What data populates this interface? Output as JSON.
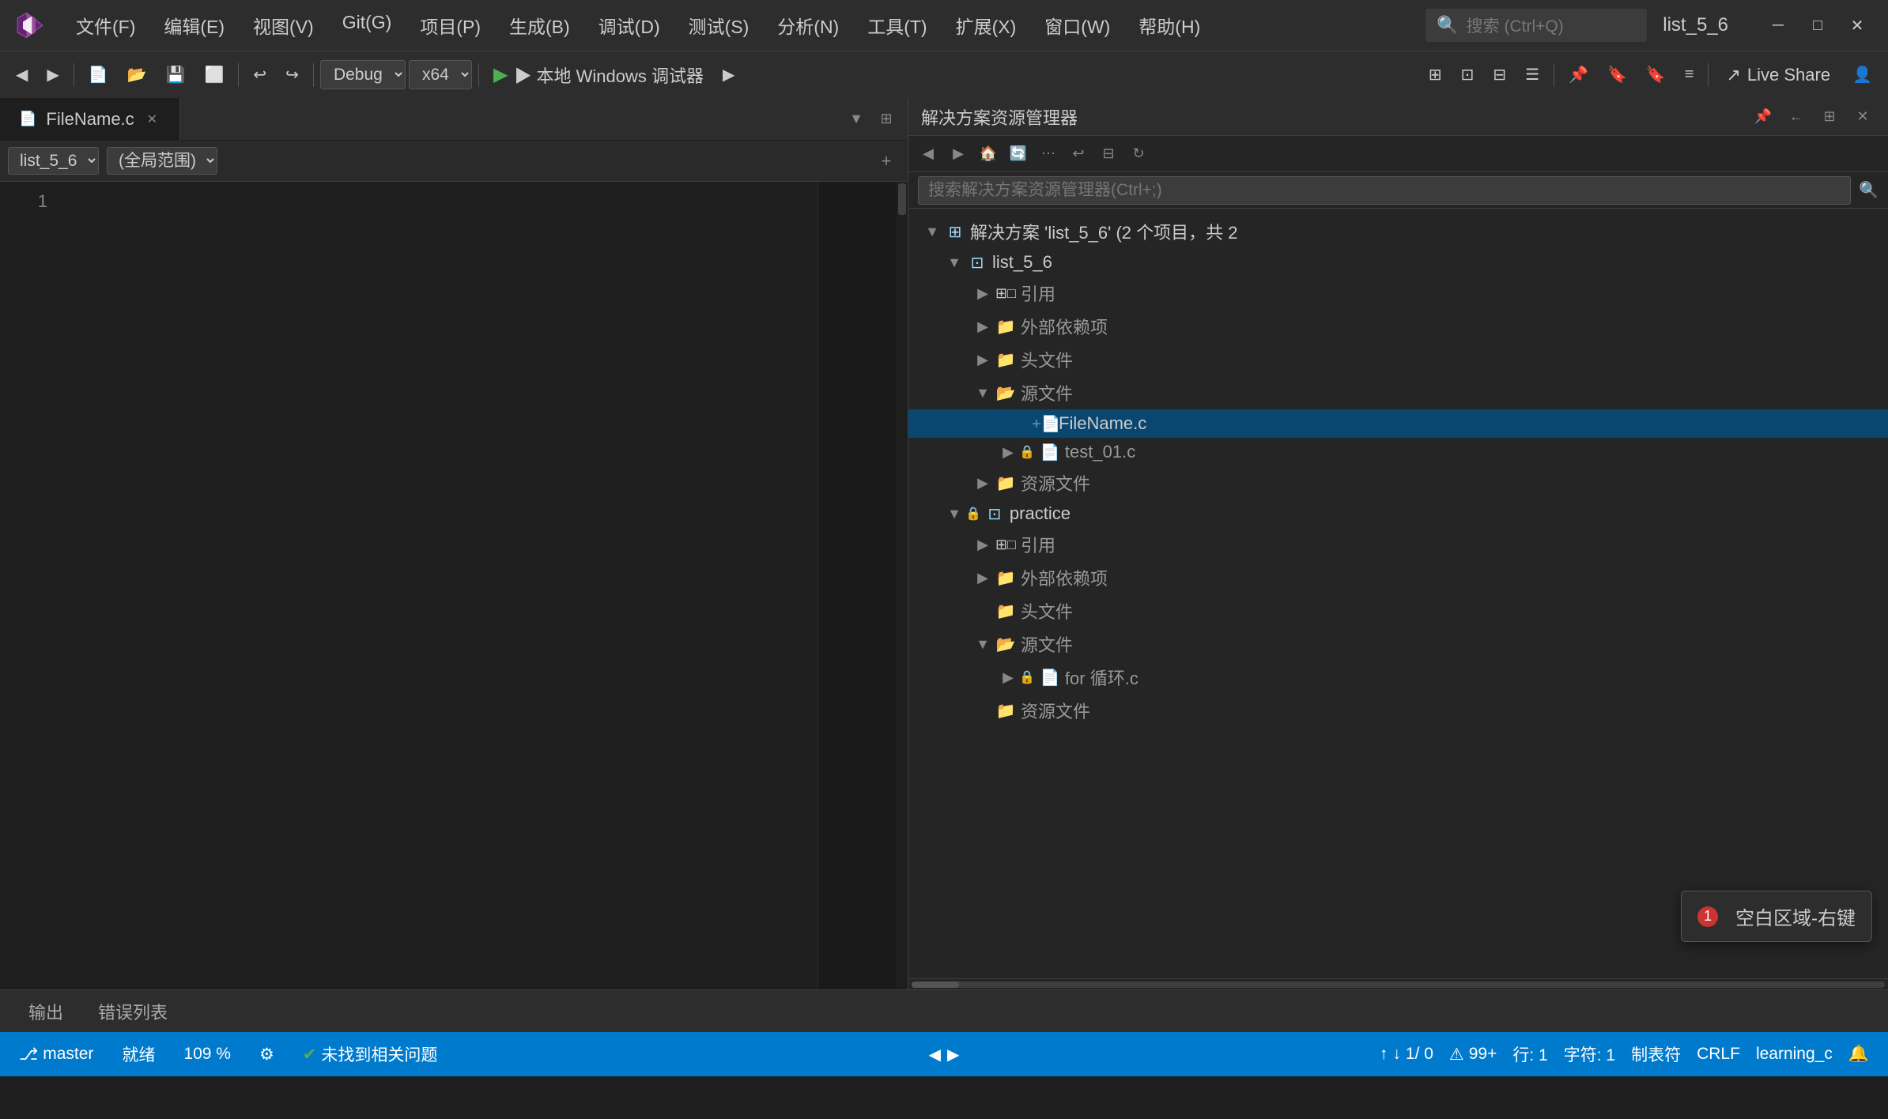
{
  "titlebar": {
    "logo_label": "VS",
    "menus": [
      {
        "label": "文件(F)"
      },
      {
        "label": "编辑(E)"
      },
      {
        "label": "视图(V)"
      },
      {
        "label": "Git(G)"
      },
      {
        "label": "项目(P)"
      },
      {
        "label": "生成(B)"
      },
      {
        "label": "调试(D)"
      },
      {
        "label": "测试(S)"
      },
      {
        "label": "分析(N)"
      },
      {
        "label": "工具(T)"
      },
      {
        "label": "扩展(X)"
      },
      {
        "label": "窗口(W)"
      },
      {
        "label": "帮助(H)"
      }
    ],
    "search_placeholder": "搜索 (Ctrl+Q)",
    "active_title": "list_5_6",
    "window_minimize": "─",
    "window_restore": "□",
    "window_close": "✕"
  },
  "toolbar": {
    "back_btn": "◀",
    "forward_btn": "▶",
    "nav_sep": "|",
    "save_btn": "💾",
    "save_all_btn": "⬜",
    "undo_btn": "↩",
    "redo_btn": "↪",
    "debug_config": "Debug",
    "arch_config": "x64",
    "play_label": "▶ 本地 Windows 调试器",
    "debug_btn2": "▶",
    "live_share_label": "Live Share",
    "user_icon": "👤"
  },
  "editor": {
    "tab_label": "FileName.c",
    "tab_close": "✕",
    "file_select": "list_5_6",
    "scope_select": "(全局范围)",
    "line_numbers": [
      "1"
    ],
    "code_lines": [
      ""
    ]
  },
  "solution_panel": {
    "title": "搜索解决方案资源管理器",
    "header_title": "解决方案资源管理器",
    "search_placeholder": "搜索解决方案资源管理器(Ctrl+;)",
    "tree": {
      "solution_label": "解决方案 'list_5_6' (2 个项目，共 2",
      "projects": [
        {
          "name": "list_5_6",
          "expanded": true,
          "children": [
            {
              "type": "references",
              "label": "引用",
              "expanded": false
            },
            {
              "type": "folder",
              "label": "外部依赖项",
              "expanded": false
            },
            {
              "type": "folder",
              "label": "头文件",
              "expanded": false
            },
            {
              "type": "folder",
              "label": "源文件",
              "expanded": true,
              "children": [
                {
                  "type": "file",
                  "label": "FileName.c",
                  "active": true
                },
                {
                  "type": "file_lock",
                  "label": "test_01.c"
                },
                {
                  "type": "folder",
                  "label": "资源文件",
                  "expanded": false
                }
              ]
            }
          ]
        },
        {
          "name": "practice",
          "expanded": true,
          "lock": true,
          "children": [
            {
              "type": "references",
              "label": "引用",
              "expanded": false
            },
            {
              "type": "folder",
              "label": "外部依赖项",
              "expanded": false
            },
            {
              "type": "folder",
              "label": "头文件",
              "expanded": false
            },
            {
              "type": "folder",
              "label": "源文件",
              "expanded": true,
              "children": [
                {
                  "type": "file_lock",
                  "label": "for 循环.c"
                },
                {
                  "type": "folder",
                  "label": "资源文件",
                  "expanded": false
                }
              ]
            }
          ]
        }
      ]
    },
    "tooltip": {
      "badge": "1",
      "text": "空白区域-右键"
    }
  },
  "bottom_tabs": [
    {
      "label": "输出"
    },
    {
      "label": "错误列表"
    }
  ],
  "statusbar": {
    "git_branch": "master",
    "repo": "learning_c",
    "errors_label": "就绪",
    "check_label": "未找到相关问题",
    "zoom": "109 %",
    "line_info": "行: 1",
    "char_info": "字符: 1",
    "line_ending": "制表符",
    "encoding": "CRLF",
    "position_info": "1/ 0",
    "warnings": "99+",
    "arrow_up": "↑",
    "arrow_down": "↓"
  }
}
